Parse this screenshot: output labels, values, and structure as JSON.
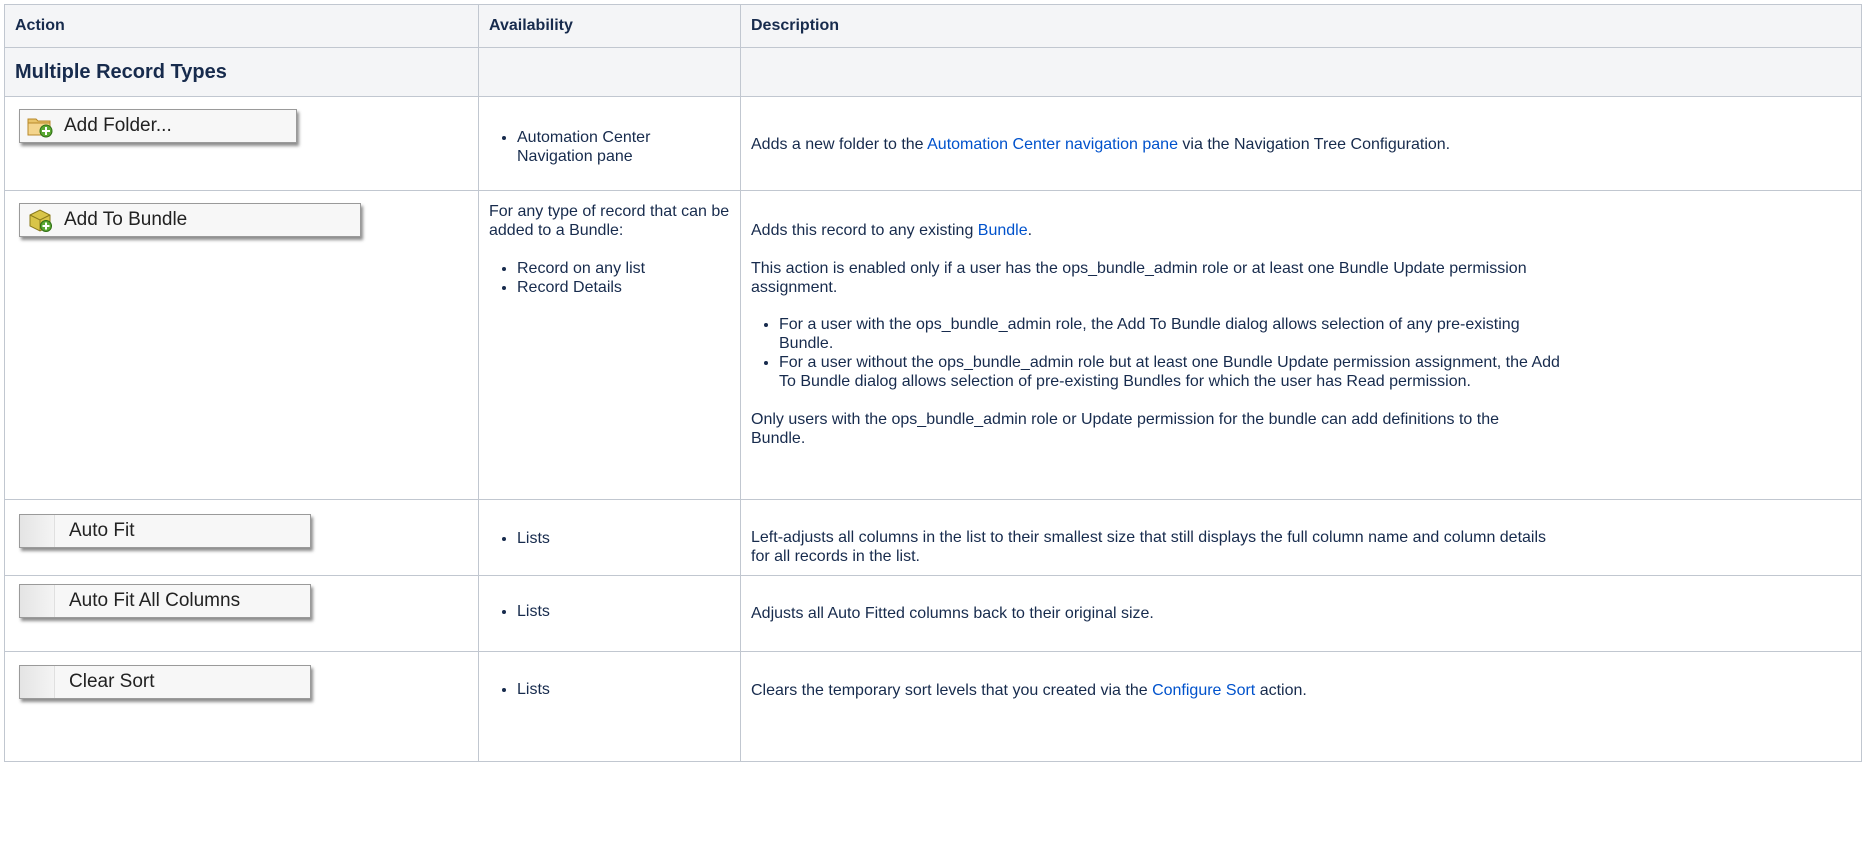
{
  "headers": {
    "action": "Action",
    "availability": "Availability",
    "description": "Description"
  },
  "section": {
    "title": "Multiple Record Types"
  },
  "rows": [
    {
      "button": "Add Folder...",
      "availability": [
        "Automation Center Navigation pane"
      ],
      "desc_pre": "Adds a new folder to the ",
      "desc_link": "Automation Center navigation pane",
      "desc_post": " via the Navigation Tree Configuration."
    },
    {
      "button": "Add To Bundle",
      "availability_intro": "For any type of record that can be added to a Bundle:",
      "availability": [
        "Record on any list",
        "Record Details"
      ],
      "desc_pre": "Adds this record to any existing ",
      "desc_link": "Bundle",
      "desc_post": ".",
      "desc_p2": "This action is enabled only if a user has the ops_bundle_admin role or at least one Bundle Update permission assignment.",
      "desc_bullets": [
        "For a user with the ops_bundle_admin role, the Add To Bundle dialog allows selection of any pre-existing Bundle.",
        "For a user without the ops_bundle_admin role but at least one Bundle Update permission assignment, the Add To Bundle dialog allows selection of pre-existing Bundles for which the user has Read permission."
      ],
      "desc_p3": "Only users with the ops_bundle_admin role or Update permission for the bundle can add definitions to the Bundle."
    },
    {
      "button": "Auto Fit",
      "availability": [
        "Lists"
      ],
      "desc": "Left-adjusts all columns in the list to their smallest size that still displays the full column name and column details for all records in the list."
    },
    {
      "button": "Auto Fit All Columns",
      "availability": [
        "Lists"
      ],
      "desc": "Adjusts all Auto Fitted columns back to their original size."
    },
    {
      "button": "Clear Sort",
      "availability": [
        "Lists"
      ],
      "desc_pre": "Clears the temporary sort levels that you created via the ",
      "desc_link": "Configure Sort",
      "desc_post": " action."
    }
  ],
  "icons": {
    "folder": "folder-add-icon",
    "bundle": "bundle-box-icon"
  },
  "colors": {
    "link": "#0052cc",
    "header_bg": "#f4f5f7",
    "border": "#c1c7d0"
  }
}
